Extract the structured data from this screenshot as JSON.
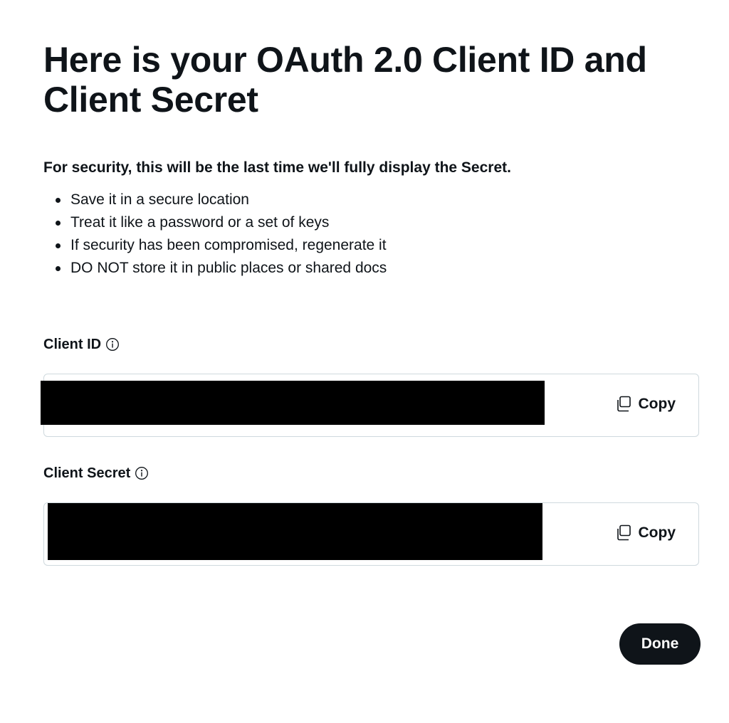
{
  "dialog": {
    "title": "Here is your OAuth 2.0 Client ID and Client Secret",
    "warning": "For security, this will be the last time we'll fully display the Secret.",
    "tips": [
      "Save it in a secure location",
      "Treat it like a password or a set of keys",
      "If security has been compromised, regenerate it",
      "DO NOT store it in public places or shared docs"
    ]
  },
  "client_id": {
    "label": "Client ID",
    "copy_label": "Copy",
    "info_icon": "info-icon",
    "copy_icon": "copy-icon"
  },
  "client_secret": {
    "label": "Client Secret",
    "copy_label": "Copy",
    "info_icon": "info-icon",
    "copy_icon": "copy-icon"
  },
  "actions": {
    "done_label": "Done"
  },
  "colors": {
    "text": "#0f1419",
    "border": "#cfd9de",
    "button_bg": "#0f1419",
    "button_text": "#ffffff",
    "redaction": "#000000"
  }
}
